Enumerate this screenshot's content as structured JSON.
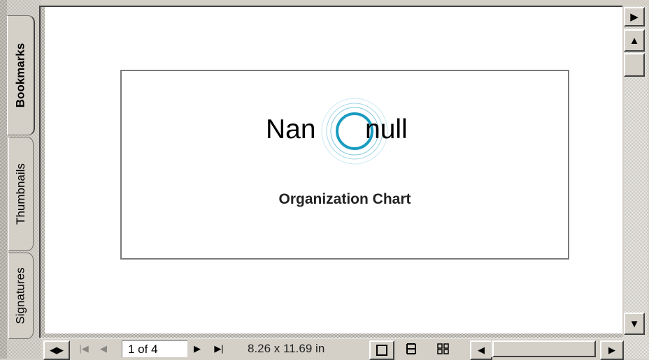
{
  "tabs": [
    {
      "label": "Bookmarks",
      "active": true
    },
    {
      "label": "Thumbnails",
      "active": false
    },
    {
      "label": "Signatures",
      "active": false
    }
  ],
  "document": {
    "logo_text_left": "Nan",
    "logo_text_right": "null",
    "title": "Organization Chart",
    "logo_ring_color": "#1a9cc0"
  },
  "toolbar": {
    "page_indicator": "1 of 4",
    "page_size": "8.26 x 11.69 in",
    "icons": {
      "split": "split-view-icon",
      "first": "first-page-icon",
      "prev": "previous-page-icon",
      "next": "next-page-icon",
      "last": "last-page-icon",
      "single": "single-page-icon",
      "continuous": "continuous-page-icon",
      "facing": "facing-pages-icon"
    }
  }
}
